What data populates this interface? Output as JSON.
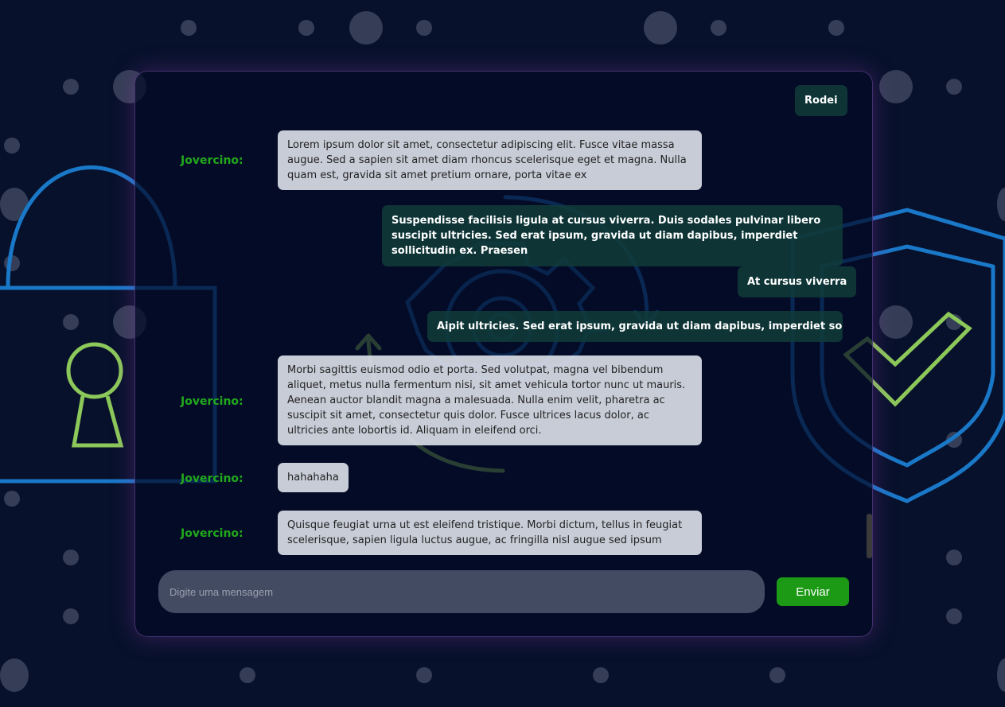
{
  "chat": {
    "messages": [
      {
        "type": "sent",
        "text": "Rodei"
      },
      {
        "type": "received",
        "sender": "Jovercino:",
        "text": "Lorem ipsum dolor sit amet, consectetur adipiscing elit. Fusce vitae massa augue. Sed a sapien sit amet diam rhoncus scelerisque eget et magna. Nulla quam est, gravida sit amet pretium ornare, porta vitae ex"
      },
      {
        "type": "sent",
        "text": "Suspendisse facilisis ligula at cursus viverra. Duis sodales pulvinar libero suscipit ultricies. Sed erat ipsum, gravida ut diam dapibus, imperdiet sollicitudin ex. Praesen"
      },
      {
        "type": "sent",
        "text": "At cursus viverra"
      },
      {
        "type": "sent",
        "text": "Aipit ultricies. Sed erat ipsum, gravida ut diam dapibus, imperdiet sollicitudin"
      },
      {
        "type": "received",
        "sender": "Jovercino:",
        "text": "Morbi sagittis euismod odio et porta. Sed volutpat, magna vel bibendum aliquet, metus nulla fermentum nisi, sit amet vehicula tortor nunc ut mauris. Aenean auctor blandit magna a malesuada. Nulla enim velit, pharetra ac suscipit sit amet, consectetur quis dolor. Fusce ultrices lacus dolor, ac ultricies ante lobortis id. Aliquam in eleifend orci."
      },
      {
        "type": "received",
        "sender": "Jovercino:",
        "text": "hahahaha"
      },
      {
        "type": "received",
        "sender": "Jovercino:",
        "text": "Quisque feugiat urna ut est eleifend tristique. Morbi dictum, tellus in feugiat scelerisque, sapien ligula luctus augue, ac fringilla nisl augue sed ipsum"
      }
    ]
  },
  "composer": {
    "placeholder": "Digite uma mensagem",
    "send_label": "Enviar"
  },
  "colors": {
    "background": "#07112b",
    "sender_name": "#22a81c",
    "send_button": "#1d9a15",
    "sent_bubble": "#103c3a",
    "received_bubble": "#dee1eb",
    "lock_outline": "#1a78c8",
    "keyhole": "#8cc85a"
  },
  "icons": [
    "padlock-icon",
    "keyhole-icon",
    "gear-icon",
    "refresh-arrows-icon",
    "shield-icon",
    "checkmark-icon"
  ]
}
